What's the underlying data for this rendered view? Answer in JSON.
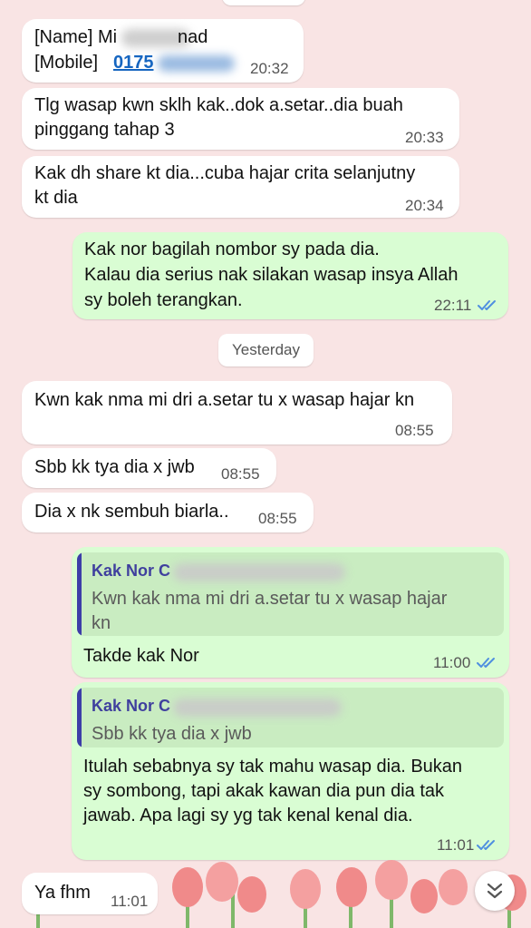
{
  "date_separator": "Yesterday",
  "messages": [
    {
      "id": "m1",
      "direction": "incoming",
      "name_line": "[Name] Mi",
      "name_tail": "nad",
      "mobile_label": "[Mobile]",
      "mobile_visible": "0175",
      "time": "20:32"
    },
    {
      "id": "m2",
      "direction": "incoming",
      "lines": [
        "Tlg wasap kwn sklh kak..dok a.setar..dia buah",
        "pinggang tahap 3"
      ],
      "time": "20:33"
    },
    {
      "id": "m3",
      "direction": "incoming",
      "lines": [
        "Kak dh share kt dia...cuba hajar crita selanjutny",
        "kt dia"
      ],
      "time": "20:34"
    },
    {
      "id": "m4",
      "direction": "outgoing",
      "lines": [
        "Kak nor bagilah nombor sy pada dia.",
        "Kalau dia serius nak silakan wasap insya Allah",
        "sy boleh terangkan."
      ],
      "time": "22:11",
      "status": "read"
    },
    {
      "id": "m5",
      "direction": "incoming",
      "lines": [
        "Kwn kak nma mi dri a.setar tu x wasap hajar kn"
      ],
      "time": "08:55"
    },
    {
      "id": "m6",
      "direction": "incoming",
      "lines": [
        "Sbb kk tya dia x jwb"
      ],
      "time": "08:55"
    },
    {
      "id": "m7",
      "direction": "incoming",
      "lines": [
        "Dia x nk sembuh biarla.."
      ],
      "time": "08:55"
    },
    {
      "id": "m8",
      "direction": "outgoing",
      "quote": {
        "author": "Kak Nor C",
        "lines": [
          "Kwn kak nma mi dri a.setar tu x wasap hajar",
          "kn"
        ]
      },
      "lines": [
        "Takde kak Nor"
      ],
      "time": "11:00",
      "status": "read"
    },
    {
      "id": "m9",
      "direction": "outgoing",
      "quote": {
        "author": "Kak Nor C",
        "lines": [
          "Sbb kk tya dia x jwb"
        ]
      },
      "lines": [
        "Itulah sebabnya sy tak mahu wasap dia. Bukan",
        "sy sombong, tapi akak kawan dia pun dia tak",
        "jawab. Apa lagi sy yg tak kenal kenal dia."
      ],
      "time": "11:01",
      "status": "read"
    },
    {
      "id": "m10",
      "direction": "incoming",
      "lines": [
        "Ya fhm"
      ],
      "time": "11:01"
    }
  ],
  "colors": {
    "incoming": "#ffffff",
    "outgoing": "#d9fdd3",
    "background": "#f9e4e4",
    "read_ticks": "#4f8fe0",
    "quote_author": "#3f3f9e"
  },
  "icons": {
    "read_receipt": "double-check-icon",
    "scroll_down": "chevron-double-down-icon"
  }
}
